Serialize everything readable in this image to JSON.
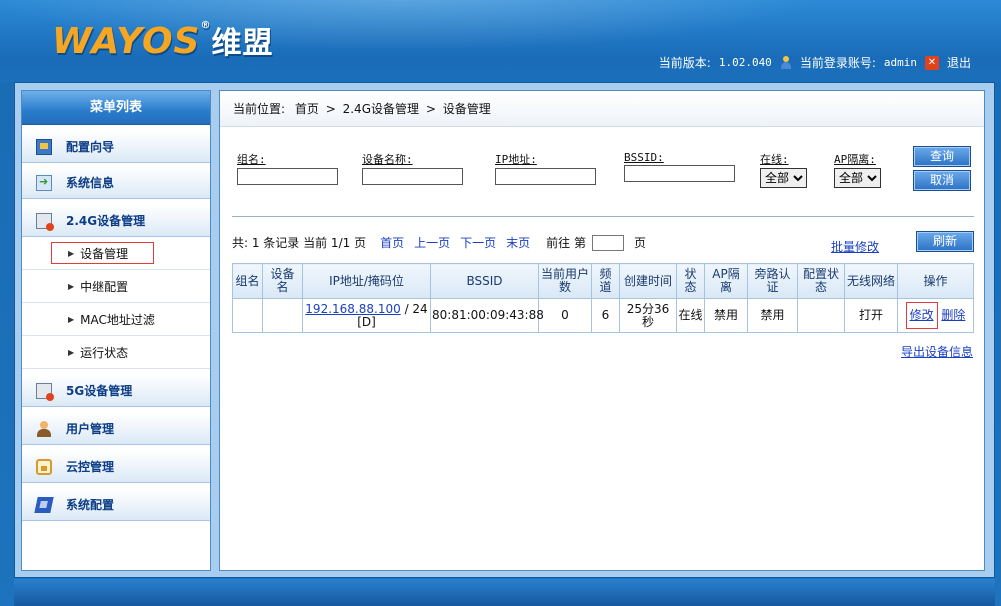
{
  "header": {
    "logo_text": "WAYOS",
    "logo_reg": "®",
    "logo_cn": "维盟",
    "version_label": "当前版本:",
    "version_value": "1.02.040",
    "account_label": "当前登录账号:",
    "account_value": "admin",
    "logout_label": "退出"
  },
  "sidebar": {
    "title": "菜单列表",
    "groups": [
      {
        "label": "配置向导",
        "icon": "wizard-icon"
      },
      {
        "label": "系统信息",
        "icon": "system-info-icon"
      },
      {
        "label": "2.4G设备管理",
        "icon": "device-icon"
      },
      {
        "label": "5G设备管理",
        "icon": "device-icon"
      },
      {
        "label": "用户管理",
        "icon": "user-icon"
      },
      {
        "label": "云控管理",
        "icon": "cloud-lock-icon"
      },
      {
        "label": "系统配置",
        "icon": "system-config-icon"
      }
    ],
    "submenu_24g": [
      {
        "label": "设备管理",
        "active": true
      },
      {
        "label": "中继配置"
      },
      {
        "label": "MAC地址过滤"
      },
      {
        "label": "运行状态"
      }
    ]
  },
  "breadcrumb": {
    "prefix": "当前位置:",
    "home": "首页",
    "section": "2.4G设备管理",
    "page": "设备管理",
    "separator": ">"
  },
  "filter": {
    "group_label": "组名:",
    "group_value": "",
    "device_label": "设备名称:",
    "device_value": "",
    "ip_label": "IP地址:",
    "ip_value": "",
    "bssid_label": "BSSID:",
    "bssid_value": "",
    "online_label": "在线:",
    "online_value": "全部",
    "isolation_label": "AP隔离:",
    "isolation_value": "全部",
    "query_button": "查询",
    "cancel_button": "取消"
  },
  "pager": {
    "summary": "共: 1 条记录 当前 1/1 页",
    "first": "首页",
    "prev": "上一页",
    "next": "下一页",
    "last": "末页",
    "goto_prefix": "前往 第",
    "goto_suffix": "页",
    "goto_value": ""
  },
  "batch_edit_link": "批量修改",
  "refresh_button": "刷新",
  "table": {
    "columns": [
      "组名",
      "设备名",
      "IP地址/掩码位",
      "BSSID",
      "当前用户数",
      "频道",
      "创建时间",
      "状态",
      "AP隔离",
      "旁路认证",
      "配置状态",
      "无线网络",
      "操作"
    ],
    "rows": [
      {
        "group": "",
        "device": "",
        "ip": "192.168.88.100",
        "mask": "/ 24",
        "ip_tag": "[D]",
        "bssid": "80:81:00:09:43:88",
        "users": "0",
        "channel": "6",
        "created": "25分36秒",
        "status": "在线",
        "isolation": "禁用",
        "bypass": "禁用",
        "config_status": "",
        "wireless": "打开",
        "edit": "修改",
        "delete": "删除"
      }
    ]
  },
  "export_link": "导出设备信息"
}
